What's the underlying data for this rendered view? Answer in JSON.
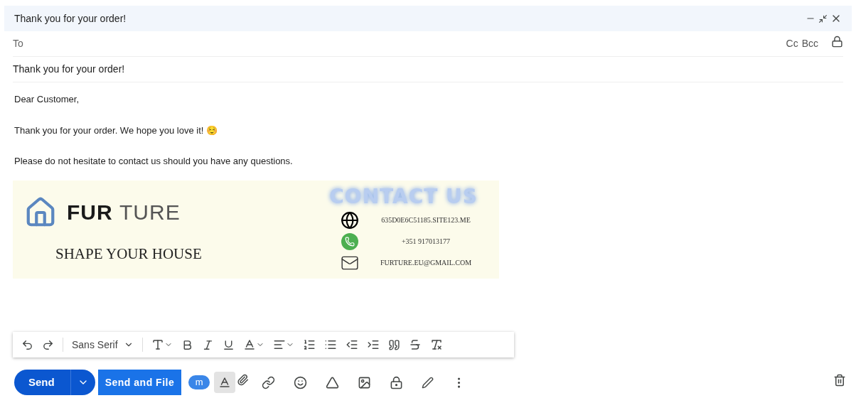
{
  "window": {
    "title": "Thank you for your order!"
  },
  "to": {
    "label": "To",
    "cc": "Cc",
    "bcc": "Bcc"
  },
  "subject": "Thank you for your order!",
  "body": {
    "paragraphs": [
      "Dear Customer,",
      "Thank you for your order. We hope you love it!",
      "Please do not hesitate to contact us should you have any questions."
    ],
    "emoji": "☺️"
  },
  "signature": {
    "brand_bold": "FUR",
    "brand_light": "TURE",
    "tagline": "SHAPE YOUR HOUSE",
    "contact_heading": "CONTACT US",
    "contacts": [
      {
        "kind": "web",
        "text": "635D0E6C51185.SITE123.ME"
      },
      {
        "kind": "phone",
        "text": "+351 917013177"
      },
      {
        "kind": "mail",
        "text": "FURTURE.EU@GMAIL.COM"
      }
    ]
  },
  "format_toolbar": {
    "font": "Sans Serif"
  },
  "actions": {
    "send": "Send",
    "send_and_file": "Send and File",
    "addon_label": "m",
    "formatting_selected": true
  }
}
